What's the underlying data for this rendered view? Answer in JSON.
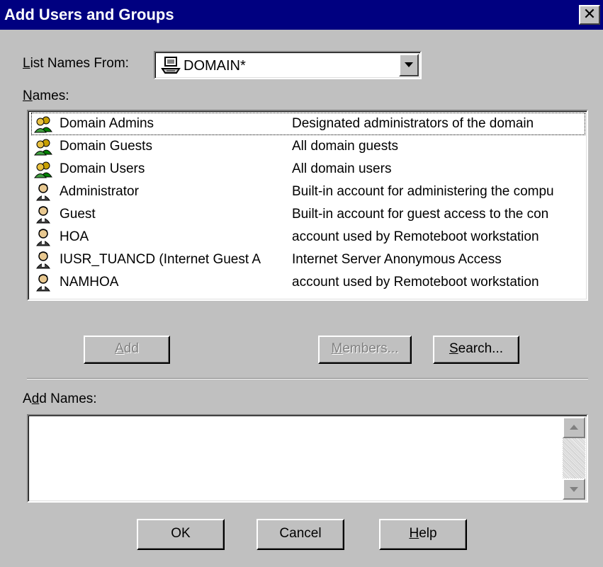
{
  "window": {
    "title": "Add Users and Groups",
    "close_glyph": "✕"
  },
  "list_names_from": {
    "label_mnemonic": "L",
    "label_rest": "ist Names From:",
    "value": "DOMAIN*",
    "icon": "computer-icon"
  },
  "names": {
    "label_mnemonic": "N",
    "label_rest": "ames:",
    "rows": [
      {
        "icon": "group-icon",
        "name": "Domain Admins",
        "description": "Designated administrators of the domain",
        "focused": true
      },
      {
        "icon": "group-icon",
        "name": "Domain Guests",
        "description": "All domain guests"
      },
      {
        "icon": "group-icon",
        "name": "Domain Users",
        "description": "All domain users"
      },
      {
        "icon": "user-icon",
        "name": "Administrator",
        "description": "Built-in account for administering the compu"
      },
      {
        "icon": "user-icon",
        "name": "Guest",
        "description": "Built-in account for guest access to the con"
      },
      {
        "icon": "user-icon",
        "name": "HOA",
        "description": "account used by Remoteboot workstation"
      },
      {
        "icon": "user-icon",
        "name": "IUSR_TUANCD (Internet Guest A",
        "description": "Internet Server Anonymous Access"
      },
      {
        "icon": "user-icon",
        "name": "NAMHOA",
        "description": "account used by Remoteboot workstation"
      }
    ]
  },
  "buttons": {
    "add_mnemonic": "A",
    "add_rest": "dd",
    "members_mnemonic": "M",
    "members_rest": "embers...",
    "search_mnemonic": "S",
    "search_rest": "earch...",
    "ok": "OK",
    "cancel": "Cancel",
    "help_mnemonic": "H",
    "help_rest": "elp"
  },
  "add_names": {
    "label_pre": "A",
    "label_mnemonic": "d",
    "label_rest": "d Names:",
    "value": ""
  },
  "colors": {
    "title_bar": "#000080",
    "face": "#c0c0c0",
    "disabled_text": "#808080"
  }
}
